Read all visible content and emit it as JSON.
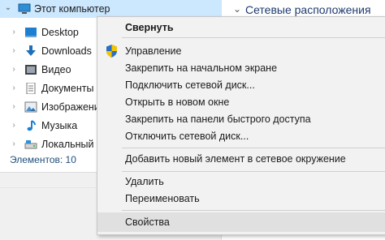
{
  "nav": {
    "root_label": "Этот компьютер",
    "items": [
      {
        "label": "Desktop",
        "icon": "desktop-icon"
      },
      {
        "label": "Downloads",
        "icon": "downloads-icon"
      },
      {
        "label": "Видео",
        "icon": "video-icon"
      },
      {
        "label": "Документы",
        "icon": "documents-icon"
      },
      {
        "label": "Изображени",
        "icon": "pictures-icon"
      },
      {
        "label": "Музыка",
        "icon": "music-icon"
      },
      {
        "label": "Локальный д",
        "icon": "local-disk-icon"
      }
    ],
    "status": "Элементов: 10"
  },
  "right_pane": {
    "header": "Сетевые расположения"
  },
  "context_menu": {
    "items": [
      {
        "label": "Свернуть",
        "bold": true
      },
      {
        "label": "Управление",
        "icon": "admin-shield-icon"
      },
      {
        "label": "Закрепить на начальном экране"
      },
      {
        "label": "Подключить сетевой диск..."
      },
      {
        "label": "Открыть в новом окне"
      },
      {
        "label": "Закрепить на панели быстрого доступа"
      },
      {
        "label": "Отключить сетевой диск..."
      },
      {
        "label": "Добавить новый элемент в сетевое окружение"
      },
      {
        "label": "Удалить"
      },
      {
        "label": "Переименовать"
      },
      {
        "label": "Свойства",
        "highlighted": true
      }
    ]
  },
  "colors": {
    "selection": "#cce8ff",
    "menu_bg": "#f2f2f2",
    "hover": "#e0e0e0",
    "status_text": "#1f4e79"
  }
}
